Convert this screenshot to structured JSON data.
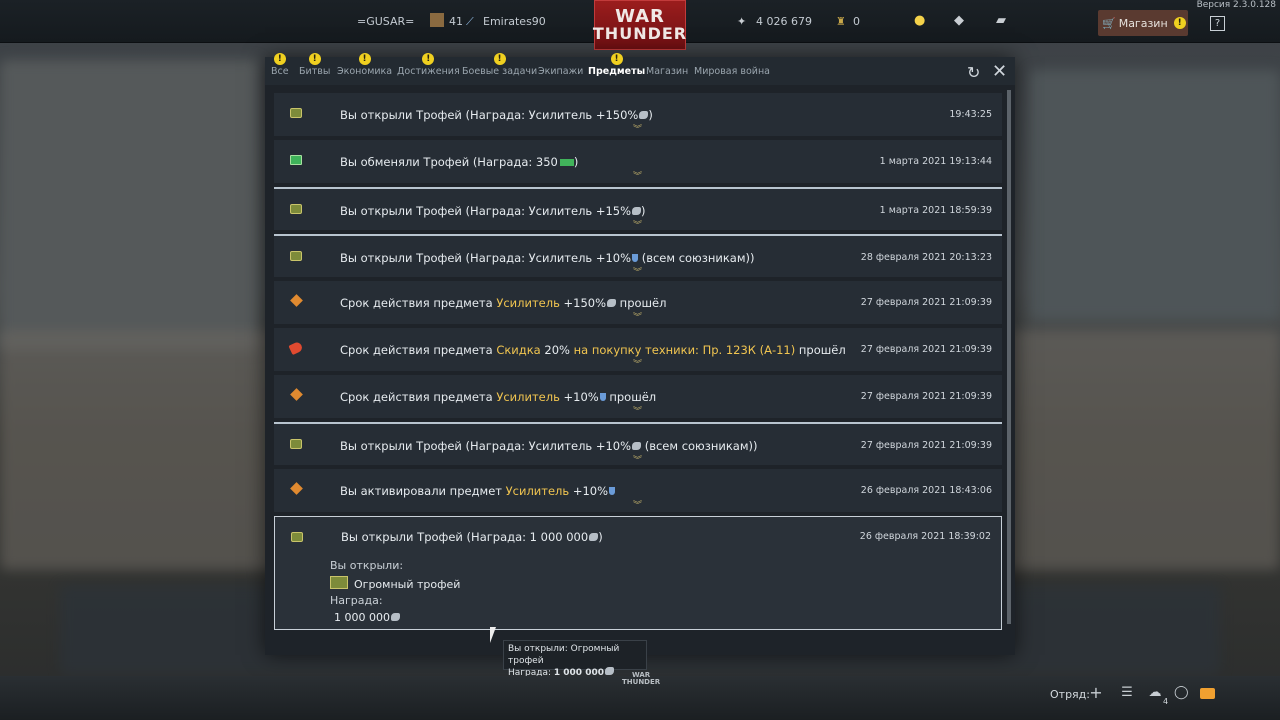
{
  "version": "Версия 2.3.0.128",
  "topbar": {
    "clan_tag": "=GUSAR=",
    "level": "41",
    "username": "Emirates90",
    "logo_line1": "WAR",
    "logo_line2": "THUNDER",
    "silver": "4 026 679",
    "golden_eagles": "0",
    "shop_label": "Магазин",
    "help_icon": "?"
  },
  "tabs": [
    {
      "label": "Все",
      "warn": true
    },
    {
      "label": "Битвы",
      "warn": true
    },
    {
      "label": "Экономика",
      "warn": true
    },
    {
      "label": "Достижения",
      "warn": true
    },
    {
      "label": "Боевые задачи",
      "warn": true
    },
    {
      "label": "Экипажи",
      "warn": false
    },
    {
      "label": "Предметы",
      "warn": true,
      "active": true
    },
    {
      "label": "Магазин",
      "warn": false
    },
    {
      "label": "Мировая война",
      "warn": false
    }
  ],
  "notifications": [
    {
      "icon": "chest-icon",
      "t1": "Вы открыли Трофей  (Награда: Усилитель +150%",
      "t2": ")",
      "inline": "lion",
      "time": "19:43:25"
    },
    {
      "icon": "money-icon",
      "t1": "Вы обменяли Трофей  (Награда: 350",
      "t2": ")",
      "inline": "money",
      "time": "1 марта 2021 19:13:44"
    },
    {
      "icon": "chest-icon",
      "t1": "Вы открыли Трофей  (Награда: Усилитель +15%",
      "t2": ")",
      "inline": "lion",
      "time": "1 марта 2021 18:59:39",
      "sep": true
    },
    {
      "icon": "chest-icon",
      "t1": "Вы открыли Трофей  (Награда: Усилитель +10%",
      "t2": " (всем союзникам))",
      "inline": "shield",
      "time": "28 февраля 2021 20:13:23",
      "sep": true
    },
    {
      "icon": "diamond-icon",
      "t1": "Срок действия предмета ",
      "hl": "Усилитель",
      "t1b": " +150%",
      "inline": "lion",
      "t2": " прошёл",
      "time": "27 февраля 2021 21:09:39"
    },
    {
      "icon": "tag-icon",
      "t1": "Срок действия предмета ",
      "hl": "Скидка",
      "t1b": " 20% ",
      "hl2": "на покупку техники: Пр. 123К (А-11)",
      "t2": " прошёл",
      "time": "27 февраля 2021 21:09:39"
    },
    {
      "icon": "diamond-icon",
      "t1": "Срок действия предмета ",
      "hl": "Усилитель",
      "t1b": " +10%",
      "inline": "shield",
      "t2": " прошёл",
      "time": "27 февраля 2021 21:09:39"
    },
    {
      "icon": "chest-icon",
      "t1": "Вы открыли Трофей  (Награда: Усилитель +10%",
      "t2": " (всем союзникам))",
      "inline": "lion",
      "time": "27 февраля 2021 21:09:39",
      "sep": true
    },
    {
      "icon": "diamond-icon",
      "t1": "Вы активировали предмет ",
      "hl": "Усилитель",
      "t1b": " +10%",
      "inline": "shield",
      "t2": "",
      "time": "26 февраля 2021 18:43:06"
    }
  ],
  "expanded": {
    "title1": "Вы открыли Трофей  (Награда: 1 000 000",
    "title2": ")",
    "time": "26 февраля 2021 18:39:02",
    "opened_label": "Вы открыли:",
    "opened_item": "Огромный трофей",
    "reward_label": "Награда:",
    "reward_value": "1 000 000"
  },
  "tooltip": {
    "line1": "Вы открыли: Огромный трофей",
    "line2_label": "Награда:",
    "line2_value": "1 000 000"
  },
  "bottombar": {
    "squad_label": "Отряд:",
    "logo_line1": "WAR",
    "logo_line2": "THUNDER",
    "friends_count": "4"
  }
}
